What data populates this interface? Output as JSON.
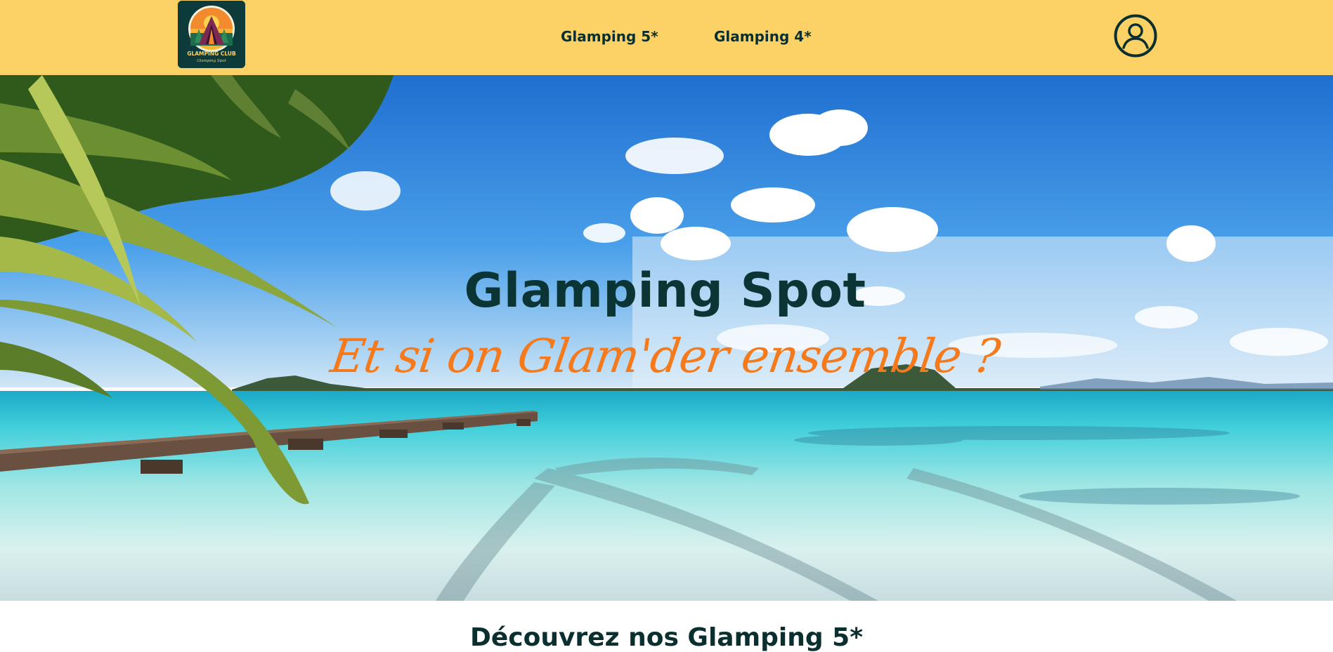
{
  "header": {
    "logo": {
      "title": "GLAMPING CLUB",
      "subtitle": "Glamping Spot",
      "icon": "tent-sunset-logo"
    },
    "nav": [
      {
        "label": "Glamping 5*"
      },
      {
        "label": "Glamping 4*"
      }
    ],
    "account_icon": "user-circle-icon"
  },
  "hero": {
    "title": "Glamping Spot",
    "tagline": "Et si on Glam'der ensemble ?",
    "image": "tropical-beach-lagoon-palm-dock"
  },
  "section": {
    "title": "Découvrez nos Glamping 5*"
  },
  "colors": {
    "header_bg": "#fcd267",
    "dark_teal": "#0b2f2f",
    "accent_orange": "#f47a1c"
  }
}
